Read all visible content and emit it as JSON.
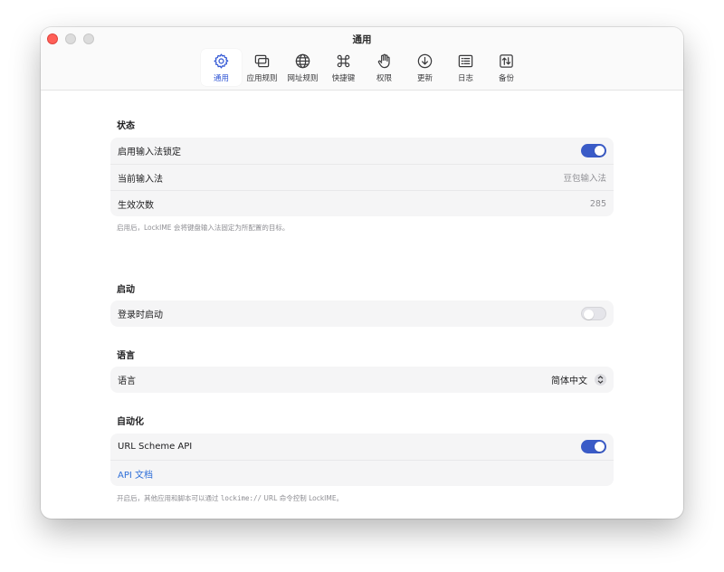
{
  "window": {
    "title": "通用"
  },
  "toolbar": {
    "tabs": [
      {
        "label": "通用",
        "icon": "gear-icon",
        "active": true
      },
      {
        "label": "应用规则",
        "icon": "app-windows-icon"
      },
      {
        "label": "网址规则",
        "icon": "globe-icon"
      },
      {
        "label": "快捷键",
        "icon": "command-icon"
      },
      {
        "label": "权限",
        "icon": "hand-icon"
      },
      {
        "label": "更新",
        "icon": "download-circle-icon"
      },
      {
        "label": "日志",
        "icon": "log-list-icon"
      },
      {
        "label": "备份",
        "icon": "backup-arrows-icon"
      }
    ]
  },
  "status": {
    "title": "状态",
    "enable_lock": {
      "label": "启用输入法锁定",
      "on": true
    },
    "current_im": {
      "label": "当前输入法",
      "value": "豆包输入法"
    },
    "effective_count": {
      "label": "生效次数",
      "value": "285"
    },
    "footnote": "启用后，LockIME 会将键盘输入法固定为所配置的目标。"
  },
  "startup": {
    "title": "启动",
    "login_launch": {
      "label": "登录时启动",
      "on": false
    }
  },
  "language": {
    "title": "语言",
    "row": {
      "label": "语言",
      "value": "简体中文"
    }
  },
  "automation": {
    "title": "自动化",
    "url_scheme": {
      "label": "URL Scheme API",
      "on": true
    },
    "api_doc_link": "API 文档",
    "footnote_pre": "开启后，其他应用和脚本可以通过 ",
    "footnote_code": "lockime://",
    "footnote_post": " URL 命令控制 LockIME。"
  },
  "colors": {
    "accent": "#3a5bc7",
    "link": "#2f6fd8",
    "close": "#ff5f57"
  }
}
